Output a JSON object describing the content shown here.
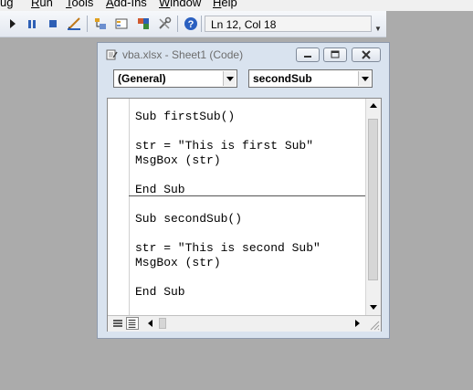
{
  "menubar": {
    "items": [
      {
        "label": "ug",
        "underline": ""
      },
      {
        "label": "Run",
        "underline": "R"
      },
      {
        "label": "Tools",
        "underline": "T"
      },
      {
        "label": "Add-Ins",
        "underline": "A"
      },
      {
        "label": "Window",
        "underline": "W"
      },
      {
        "label": "Help",
        "underline": "H"
      }
    ]
  },
  "toolbar": {
    "icons": [
      "run-icon",
      "break-icon",
      "reset-icon",
      "design-mode-icon",
      "project-explorer-icon",
      "properties-window-icon",
      "object-browser-icon",
      "toolbox-icon",
      "help-icon"
    ],
    "cursor_position": "Ln 12, Col 18"
  },
  "code_window": {
    "title": "vba.xlsx - Sheet1 (Code)",
    "object_combo": "(General)",
    "procedure_combo": "secondSub",
    "lines": [
      "Sub firstSub()",
      "",
      "str = \"This is first Sub\"",
      "MsgBox (str)",
      "",
      "End Sub",
      "Sub secondSub()",
      "",
      "str = \"This is second Sub\"",
      "MsgBox (str)",
      "",
      "End Sub"
    ]
  },
  "colors": {
    "desktop": "#ababab",
    "window_frame": "#d9e3ef",
    "title_text": "#6d6d6d",
    "help_icon": "#2b60c0",
    "close_x": "#c0392b"
  }
}
